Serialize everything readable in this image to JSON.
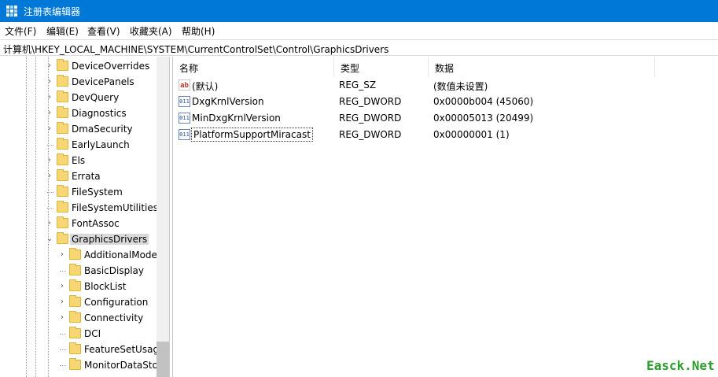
{
  "window": {
    "title": "注册表编辑器",
    "accent_color": "#0078d7"
  },
  "menu": [
    {
      "label": "文件(F)"
    },
    {
      "label": "编辑(E)"
    },
    {
      "label": "查看(V)"
    },
    {
      "label": "收藏夹(A)"
    },
    {
      "label": "帮助(H)"
    }
  ],
  "address": {
    "path": "计算机\\HKEY_LOCAL_MACHINE\\SYSTEM\\CurrentControlSet\\Control\\GraphicsDrivers"
  },
  "tree": {
    "items": [
      {
        "label": "DeviceOverrides",
        "expander": "›",
        "icon": "folder-icon"
      },
      {
        "label": "DevicePanels",
        "expander": "›",
        "icon": "folder-icon"
      },
      {
        "label": "DevQuery",
        "expander": "›",
        "icon": "folder-icon"
      },
      {
        "label": "Diagnostics",
        "expander": "›",
        "icon": "folder-icon"
      },
      {
        "label": "DmaSecurity",
        "expander": "›",
        "icon": "folder-icon"
      },
      {
        "label": "EarlyLaunch",
        "expander": "",
        "icon": "folder-icon"
      },
      {
        "label": "Els",
        "expander": "›",
        "icon": "folder-icon"
      },
      {
        "label": "Errata",
        "expander": "›",
        "icon": "folder-icon"
      },
      {
        "label": "FileSystem",
        "expander": "",
        "icon": "folder-icon"
      },
      {
        "label": "FileSystemUtilities",
        "expander": "",
        "icon": "folder-icon"
      },
      {
        "label": "FontAssoc",
        "expander": "›",
        "icon": "folder-icon"
      },
      {
        "label": "GraphicsDrivers",
        "expander": "⌄",
        "icon": "folder-icon",
        "selected": true
      },
      {
        "label": "AdditionalMode",
        "expander": "›",
        "icon": "folder-icon"
      },
      {
        "label": "BasicDisplay",
        "expander": "",
        "icon": "folder-icon"
      },
      {
        "label": "BlockList",
        "expander": "›",
        "icon": "folder-icon"
      },
      {
        "label": "Configuration",
        "expander": "›",
        "icon": "folder-icon"
      },
      {
        "label": "Connectivity",
        "expander": "›",
        "icon": "folder-icon"
      },
      {
        "label": "DCI",
        "expander": "",
        "icon": "folder-icon"
      },
      {
        "label": "FeatureSetUsag",
        "expander": "",
        "icon": "folder-icon"
      },
      {
        "label": "MonitorDataSto",
        "expander": "",
        "icon": "folder-icon"
      }
    ]
  },
  "values": {
    "headers": {
      "name": "名称",
      "type": "类型",
      "data": "数据"
    },
    "rows": [
      {
        "icon": "string-value-icon",
        "icon_text": "ab",
        "name": "(默认)",
        "type": "REG_SZ",
        "data": "(数值未设置)"
      },
      {
        "icon": "binary-value-icon",
        "icon_text": "011",
        "name": "DxgKrnlVersion",
        "type": "REG_DWORD",
        "data": "0x0000b004 (45060)"
      },
      {
        "icon": "binary-value-icon",
        "icon_text": "011",
        "name": "MinDxgKrnlVersion",
        "type": "REG_DWORD",
        "data": "0x00005013 (20499)"
      },
      {
        "icon": "binary-value-icon",
        "icon_text": "011",
        "name": "PlatformSupportMiracast",
        "type": "REG_DWORD",
        "data": "0x00000001 (1)",
        "focused": true
      }
    ]
  },
  "watermark": {
    "text": "Easck.Net"
  }
}
